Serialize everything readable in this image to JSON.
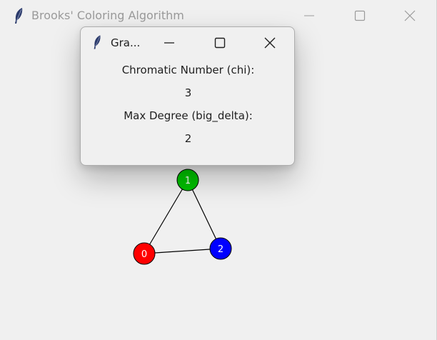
{
  "main_window": {
    "title": "Brooks' Coloring Algorithm",
    "controls": [
      "minimize",
      "maximize",
      "close"
    ]
  },
  "dialog": {
    "title": "Gra...",
    "chromatic_label": "Chromatic Number (chi):",
    "chromatic_value": "3",
    "degree_label": "Max Degree (big_delta):",
    "degree_value": "2"
  },
  "graph": {
    "nodes": [
      {
        "label": "1",
        "color": "#00c000"
      },
      {
        "label": "0",
        "color": "#ff0000"
      },
      {
        "label": "2",
        "color": "#0000ff"
      }
    ],
    "edges": [
      [
        "1",
        "0"
      ],
      [
        "1",
        "2"
      ],
      [
        "0",
        "2"
      ]
    ],
    "edge_color": "#000000"
  },
  "icons": {
    "app_icon": "feather-icon",
    "min": "minimize-icon",
    "max": "maximize-icon",
    "close": "close-icon"
  }
}
